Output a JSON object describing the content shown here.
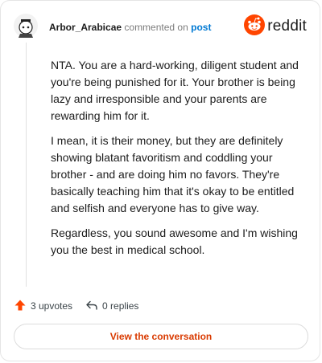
{
  "comment": {
    "author": "Arbor_Arabicae",
    "verb": "commented on",
    "target_link": "post",
    "paragraphs": [
      "NTA. You are a hard-working, diligent student and you're being punished for it. Your brother is being lazy and irresponsible and your parents are rewarding him for it.",
      "I mean, it is their money, but they are definitely showing blatant favoritism and coddling your brother - and are doing him no favors. They're basically teaching him that it's okay to be entitled and selfish and everyone has to give way.",
      "Regardless, you sound awesome and I'm wishing you the best in medical school."
    ]
  },
  "brand": {
    "name": "reddit",
    "icon": "reddit-logo-icon",
    "color": "#ff4500"
  },
  "actions": {
    "upvotes_label": "3 upvotes",
    "upvote_icon": "upvote-arrow-icon",
    "upvote_color": "#ff4500",
    "replies_label": "0 replies",
    "reply_icon": "reply-arrow-icon"
  },
  "footer": {
    "button_label": "View the conversation",
    "button_color": "#d93a00"
  }
}
